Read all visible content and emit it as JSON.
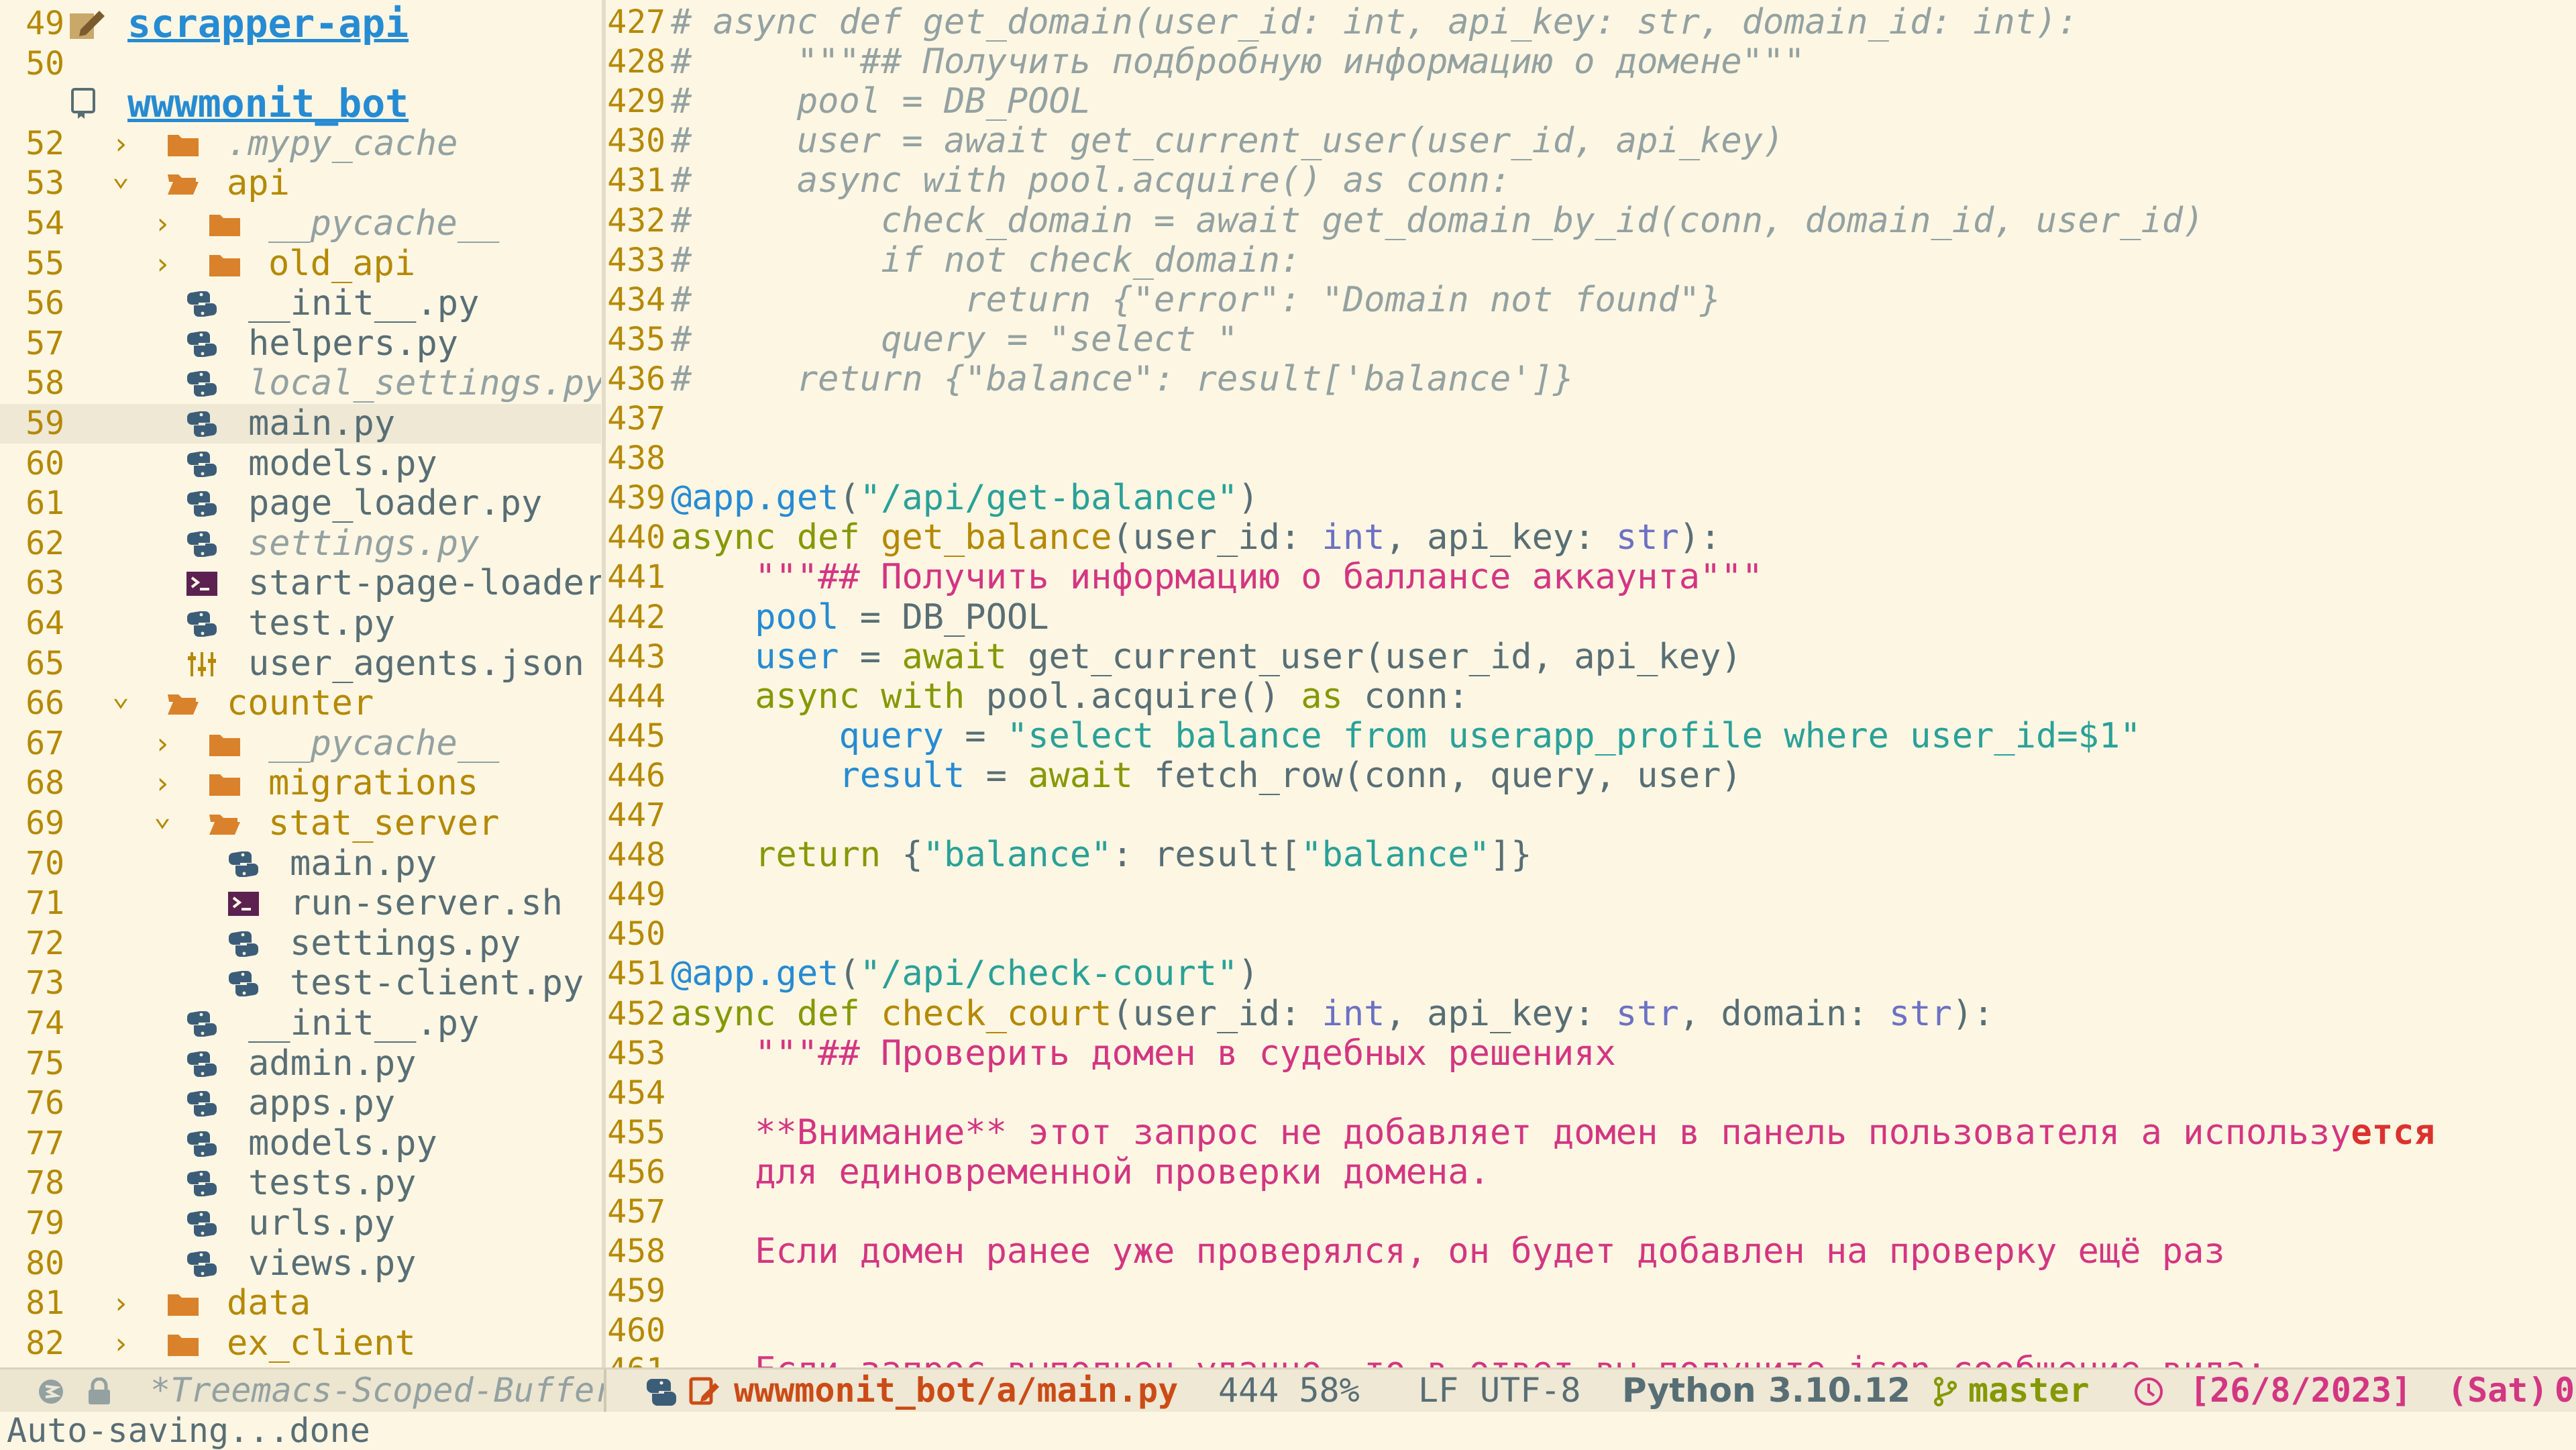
{
  "sidebar": {
    "rows": [
      {
        "ln": "49",
        "kind": "project",
        "icon": "edit-project-icon",
        "text": "scrapper-api",
        "indent": 0
      },
      {
        "ln": "50",
        "kind": "blank",
        "text": ""
      },
      {
        "ln": "",
        "kind": "project",
        "icon": "repo-icon",
        "text": "wwwmonit_bot",
        "indent": 0
      },
      {
        "ln": "52",
        "kind": "dir",
        "open": false,
        "text": ".mypy_cache",
        "ignored": true,
        "depth": 1
      },
      {
        "ln": "53",
        "kind": "dir",
        "open": true,
        "text": "api",
        "depth": 1
      },
      {
        "ln": "54",
        "kind": "dir",
        "open": false,
        "text": "__pycache__",
        "ignored": true,
        "depth": 2
      },
      {
        "ln": "55",
        "kind": "dir",
        "open": false,
        "text": "old_api",
        "depth": 2
      },
      {
        "ln": "56",
        "kind": "file",
        "ftype": "python",
        "text": "__init__.py",
        "depth": 2
      },
      {
        "ln": "57",
        "kind": "file",
        "ftype": "python",
        "text": "helpers.py",
        "depth": 2
      },
      {
        "ln": "58",
        "kind": "file",
        "ftype": "python",
        "text": "local_settings.py",
        "ignored": true,
        "depth": 2
      },
      {
        "ln": "59",
        "kind": "file",
        "ftype": "python",
        "text": "main.py",
        "depth": 2,
        "selected": true
      },
      {
        "ln": "60",
        "kind": "file",
        "ftype": "python",
        "text": "models.py",
        "depth": 2
      },
      {
        "ln": "61",
        "kind": "file",
        "ftype": "python",
        "text": "page_loader.py",
        "depth": 2
      },
      {
        "ln": "62",
        "kind": "file",
        "ftype": "python",
        "text": "settings.py",
        "ignored": true,
        "depth": 2
      },
      {
        "ln": "63",
        "kind": "file",
        "ftype": "shell",
        "text": "start-page-loader.",
        "depth": 2
      },
      {
        "ln": "64",
        "kind": "file",
        "ftype": "python",
        "text": "test.py",
        "depth": 2
      },
      {
        "ln": "65",
        "kind": "file",
        "ftype": "json",
        "text": "user_agents.json",
        "depth": 2
      },
      {
        "ln": "66",
        "kind": "dir",
        "open": true,
        "text": "counter",
        "depth": 1
      },
      {
        "ln": "67",
        "kind": "dir",
        "open": false,
        "text": "__pycache__",
        "ignored": true,
        "depth": 2
      },
      {
        "ln": "68",
        "kind": "dir",
        "open": false,
        "text": "migrations",
        "depth": 2
      },
      {
        "ln": "69",
        "kind": "dir",
        "open": true,
        "text": "stat_server",
        "depth": 2
      },
      {
        "ln": "70",
        "kind": "file",
        "ftype": "python",
        "text": "main.py",
        "depth": 3
      },
      {
        "ln": "71",
        "kind": "file",
        "ftype": "shell",
        "text": "run-server.sh",
        "depth": 3
      },
      {
        "ln": "72",
        "kind": "file",
        "ftype": "python",
        "text": "settings.py",
        "depth": 3
      },
      {
        "ln": "73",
        "kind": "file",
        "ftype": "python",
        "text": "test-client.py",
        "depth": 3
      },
      {
        "ln": "74",
        "kind": "file",
        "ftype": "python",
        "text": "__init__.py",
        "depth": 2
      },
      {
        "ln": "75",
        "kind": "file",
        "ftype": "python",
        "text": "admin.py",
        "depth": 2
      },
      {
        "ln": "76",
        "kind": "file",
        "ftype": "python",
        "text": "apps.py",
        "depth": 2
      },
      {
        "ln": "77",
        "kind": "file",
        "ftype": "python",
        "text": "models.py",
        "depth": 2
      },
      {
        "ln": "78",
        "kind": "file",
        "ftype": "python",
        "text": "tests.py",
        "depth": 2
      },
      {
        "ln": "79",
        "kind": "file",
        "ftype": "python",
        "text": "urls.py",
        "depth": 2
      },
      {
        "ln": "80",
        "kind": "file",
        "ftype": "python",
        "text": "views.py",
        "depth": 2
      },
      {
        "ln": "81",
        "kind": "dir",
        "open": false,
        "text": "data",
        "depth": 1
      },
      {
        "ln": "82",
        "kind": "dir",
        "open": false,
        "text": "ex_client",
        "depth": 1
      }
    ]
  },
  "editor": {
    "lines": [
      {
        "ln": "427",
        "tokens": [
          [
            "cm",
            "# async def get_domain(user_id: int, api_key: str, domain_id: int):"
          ]
        ]
      },
      {
        "ln": "428",
        "tokens": [
          [
            "cm",
            "#     \"\"\"## Получить подбробную информацию о домене\"\"\""
          ]
        ]
      },
      {
        "ln": "429",
        "tokens": [
          [
            "cm",
            "#     pool = DB_POOL"
          ]
        ]
      },
      {
        "ln": "430",
        "tokens": [
          [
            "cm",
            "#     user = await get_current_user(user_id, api_key)"
          ]
        ]
      },
      {
        "ln": "431",
        "tokens": [
          [
            "cm",
            "#     async with pool.acquire() as conn:"
          ]
        ]
      },
      {
        "ln": "432",
        "tokens": [
          [
            "cm",
            "#         check_domain = await get_domain_by_id(conn, domain_id, user_id)"
          ]
        ]
      },
      {
        "ln": "433",
        "tokens": [
          [
            "cm",
            "#         if not check_domain:"
          ]
        ]
      },
      {
        "ln": "434",
        "tokens": [
          [
            "cm",
            "#             return {\"error\": \"Domain not found\"}"
          ]
        ]
      },
      {
        "ln": "435",
        "tokens": [
          [
            "cm",
            "#         query = \"select \""
          ]
        ]
      },
      {
        "ln": "436",
        "tokens": [
          [
            "cm",
            "#     return {\"balance\": result['balance']}"
          ]
        ]
      },
      {
        "ln": "437",
        "tokens": []
      },
      {
        "ln": "438",
        "tokens": []
      },
      {
        "ln": "439",
        "tokens": [
          [
            "dec",
            "@app.get"
          ],
          [
            "pl",
            "("
          ],
          [
            "str",
            "\"/api/get-balance\""
          ],
          [
            "pl",
            ")"
          ]
        ]
      },
      {
        "ln": "440",
        "tokens": [
          [
            "kw",
            "async def "
          ],
          [
            "fn",
            "get_balance"
          ],
          [
            "pl",
            "(user_id: "
          ],
          [
            "ty",
            "int"
          ],
          [
            "pl",
            ", api_key: "
          ],
          [
            "ty",
            "str"
          ],
          [
            "pl",
            "):"
          ]
        ]
      },
      {
        "ln": "441",
        "tokens": [
          [
            "pl",
            "    "
          ],
          [
            "doc",
            "\"\"\"## Получить информацию о баллансе аккаунта\"\"\""
          ]
        ]
      },
      {
        "ln": "442",
        "tokens": [
          [
            "pl",
            "    "
          ],
          [
            "var",
            "pool"
          ],
          [
            "pl",
            " = DB_POOL"
          ]
        ]
      },
      {
        "ln": "443",
        "tokens": [
          [
            "pl",
            "    "
          ],
          [
            "var",
            "user"
          ],
          [
            "pl",
            " = "
          ],
          [
            "kw",
            "await"
          ],
          [
            "pl",
            " get_current_user(user_id, api_key)"
          ]
        ]
      },
      {
        "ln": "444",
        "tokens": [
          [
            "pl",
            "    "
          ],
          [
            "kw",
            "async with"
          ],
          [
            "pl",
            " pool.acquire() "
          ],
          [
            "kw",
            "as"
          ],
          [
            "pl",
            " conn:"
          ]
        ]
      },
      {
        "ln": "445",
        "tokens": [
          [
            "pl",
            "        "
          ],
          [
            "var",
            "query"
          ],
          [
            "pl",
            " = "
          ],
          [
            "str",
            "\"select balance from userapp_profile where user_id=$1\""
          ]
        ]
      },
      {
        "ln": "446",
        "tokens": [
          [
            "pl",
            "        "
          ],
          [
            "var",
            "result"
          ],
          [
            "pl",
            " = "
          ],
          [
            "kw",
            "await"
          ],
          [
            "pl",
            " fetch_row(conn, query, user)"
          ]
        ]
      },
      {
        "ln": "447",
        "tokens": []
      },
      {
        "ln": "448",
        "tokens": [
          [
            "pl",
            "    "
          ],
          [
            "kw",
            "return"
          ],
          [
            "pl",
            " {"
          ],
          [
            "str",
            "\"balance\""
          ],
          [
            "pl",
            ": result["
          ],
          [
            "str",
            "\"balance\""
          ],
          [
            "pl",
            "]}"
          ]
        ]
      },
      {
        "ln": "449",
        "tokens": []
      },
      {
        "ln": "450",
        "tokens": []
      },
      {
        "ln": "451",
        "tokens": [
          [
            "dec",
            "@app.get"
          ],
          [
            "pl",
            "("
          ],
          [
            "str",
            "\"/api/check-court\""
          ],
          [
            "pl",
            ")"
          ]
        ]
      },
      {
        "ln": "452",
        "tokens": [
          [
            "kw",
            "async def "
          ],
          [
            "fn",
            "check_court"
          ],
          [
            "pl",
            "(user_id: "
          ],
          [
            "ty",
            "int"
          ],
          [
            "pl",
            ", api_key: "
          ],
          [
            "ty",
            "str"
          ],
          [
            "pl",
            ", domain: "
          ],
          [
            "ty",
            "str"
          ],
          [
            "pl",
            "):"
          ]
        ]
      },
      {
        "ln": "453",
        "tokens": [
          [
            "pl",
            "    "
          ],
          [
            "doc",
            "\"\"\"## Проверить домен в судебных решениях"
          ]
        ]
      },
      {
        "ln": "454",
        "tokens": []
      },
      {
        "ln": "455",
        "tokens": [
          [
            "pl",
            "    "
          ],
          [
            "doc",
            "**Внимание** этот запрос не добавляет домен в панель пользователя а использу"
          ],
          [
            "warn",
            "ется"
          ]
        ]
      },
      {
        "ln": "456",
        "tokens": [
          [
            "pl",
            "    "
          ],
          [
            "doc",
            "для единовременной проверки домена."
          ]
        ]
      },
      {
        "ln": "457",
        "tokens": []
      },
      {
        "ln": "458",
        "tokens": [
          [
            "pl",
            "    "
          ],
          [
            "doc",
            "Если домен ранее уже проверялся, он будет добавлен на проверку ещё раз"
          ]
        ]
      },
      {
        "ln": "459",
        "tokens": []
      },
      {
        "ln": "460",
        "tokens": []
      },
      {
        "ln": "461",
        "tokens": [
          [
            "pl",
            "    "
          ],
          [
            "doc",
            "Если запрос выполнен удачно, то в ответ вы получите json сообщение вида:"
          ]
        ]
      }
    ]
  },
  "modeline": {
    "left_buffer": "*Treemacs-Scoped-Buffer",
    "file_path": "wwwmonit_bot/a/main.py",
    "position": "444 58%",
    "eol": "LF",
    "encoding": "UTF-8",
    "mode": "Python",
    "version": "3.10.12",
    "branch": "master",
    "date": "[26/8/2023]",
    "day": "(Sat)",
    "trail": "0"
  },
  "minibuffer": {
    "text": "Auto-saving...done"
  },
  "colors": {
    "background": "#fdf6e3",
    "line_number": "#b58900",
    "keyword": "#859900",
    "string": "#2aa198",
    "docstring": "#d33682",
    "variable": "#268bd2",
    "type": "#6c71c4",
    "comment": "#93a1a1",
    "modified_file": "#cb4b16"
  }
}
